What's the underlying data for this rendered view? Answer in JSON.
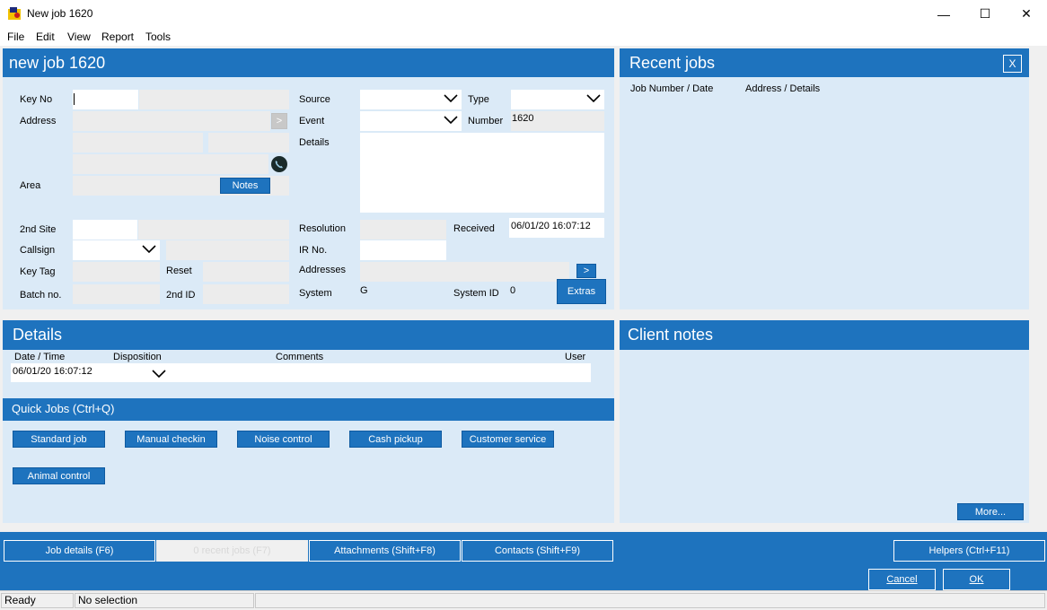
{
  "window": {
    "title": "New job 1620"
  },
  "menu": {
    "file": "File",
    "edit": "Edit",
    "view": "View",
    "report": "Report",
    "tools": "Tools"
  },
  "job_panel": {
    "title": "new job 1620",
    "labels": {
      "key_no": "Key No",
      "address": "Address",
      "area": "Area",
      "source": "Source",
      "type": "Type",
      "event": "Event",
      "number": "Number",
      "details": "Details",
      "second_site": "2nd Site",
      "callsign": "Callsign",
      "key_tag": "Key Tag",
      "reset": "Reset",
      "batch_no": "Batch no.",
      "second_id": "2nd ID",
      "resolution": "Resolution",
      "received": "Received",
      "ir_no": "IR No.",
      "addresses": "Addresses",
      "system": "System",
      "system_id": "System ID"
    },
    "values": {
      "number": "1620",
      "received": "06/01/20 16:07:12",
      "system": "G",
      "system_id": "0"
    },
    "buttons": {
      "address_go": ">",
      "notes": "Notes",
      "addresses_go": ">",
      "extras": "Extras"
    }
  },
  "recent_jobs": {
    "title": "Recent jobs",
    "close": "X",
    "col_job": "Job Number / Date",
    "col_address": "Address / Details"
  },
  "details": {
    "title": "Details",
    "cols": {
      "datetime": "Date / Time",
      "disposition": "Disposition",
      "comments": "Comments",
      "user": "User"
    },
    "row": {
      "datetime": "06/01/20 16:07:12"
    }
  },
  "quick_jobs": {
    "title": "Quick Jobs (Ctrl+Q)",
    "buttons": [
      "Standard job",
      "Manual checkin",
      "Noise control",
      "Cash pickup",
      "Customer service",
      "Animal control"
    ]
  },
  "client_notes": {
    "title": "Client notes",
    "more": "More..."
  },
  "tabs": {
    "job_details": "Job details (F6)",
    "recent_jobs": "0 recent jobs (F7)",
    "attachments": "Attachments (Shift+F8)",
    "contacts": "Contacts (Shift+F9)",
    "helpers": "Helpers (Ctrl+F11)"
  },
  "dialog": {
    "cancel": "Cancel",
    "ok": "OK"
  },
  "status": {
    "ready": "Ready",
    "selection": "No selection"
  },
  "colors": {
    "accent": "#1e73be",
    "panel_bg": "#dbeaf7"
  },
  "icons": {
    "app": "app-icon",
    "phone": "phone-icon",
    "dropdown": "chevron-down-icon"
  }
}
